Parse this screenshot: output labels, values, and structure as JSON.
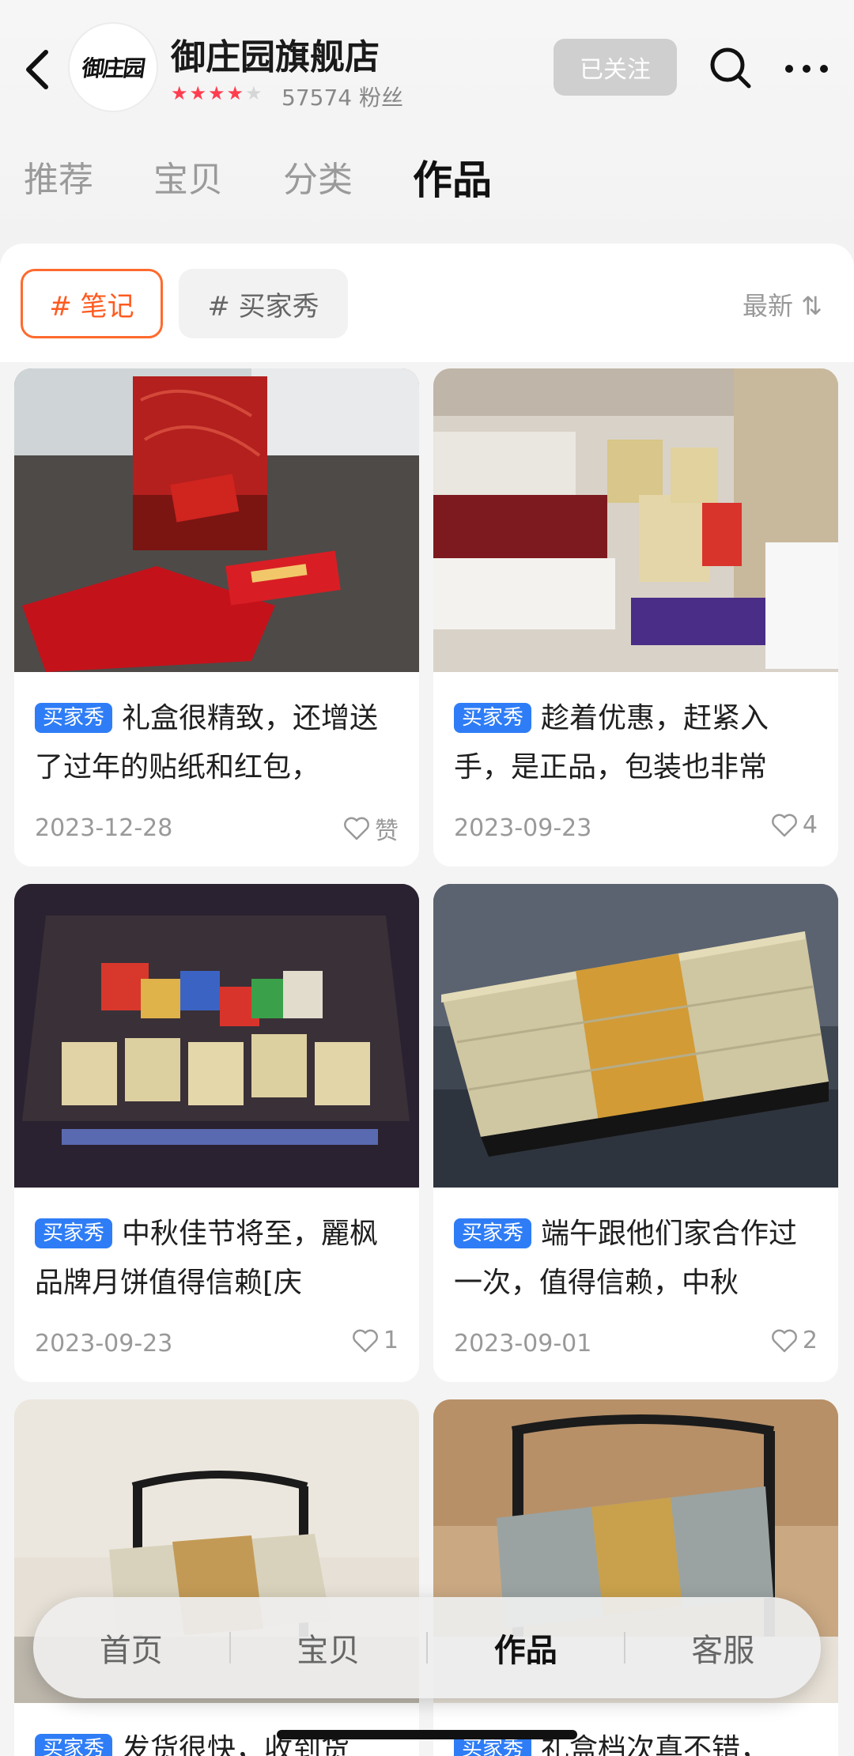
{
  "header": {
    "logo_text": "御庄园",
    "shop_name": "御庄园旗舰店",
    "rating_stars": 4,
    "fans_text": "57574 粉丝",
    "follow_label": "已关注"
  },
  "tabs": [
    {
      "label": "推荐",
      "active": false
    },
    {
      "label": "宝贝",
      "active": false
    },
    {
      "label": "分类",
      "active": false
    },
    {
      "label": "作品",
      "active": true
    }
  ],
  "filters": {
    "note": "# 笔记",
    "buyer_show": "# 买家秀",
    "sort": "最新 ⇅"
  },
  "posts": [
    {
      "badge": "买家秀",
      "title": "礼盒很精致，还增送了过年的贴纸和红包，",
      "date": "2023-12-28",
      "likes": "赞"
    },
    {
      "badge": "买家秀",
      "title": "趁着优惠，赶紧入手，是正品，包装也非常",
      "date": "2023-09-23",
      "likes": "4"
    },
    {
      "badge": "买家秀",
      "title": "中秋佳节将至，麗枫品牌月饼值得信赖[庆",
      "date": "2023-09-23",
      "likes": "1"
    },
    {
      "badge": "买家秀",
      "title": "端午跟他们家合作过一次，值得信赖，中秋",
      "date": "2023-09-01",
      "likes": "2"
    },
    {
      "badge": "买家秀",
      "title": "发货很快，收到货",
      "date": "",
      "likes": ""
    },
    {
      "badge": "买家秀",
      "title": "礼盒档次真不错，",
      "date": "",
      "likes": ""
    }
  ],
  "bottom_nav": [
    {
      "label": "首页",
      "active": false
    },
    {
      "label": "宝贝",
      "active": false
    },
    {
      "label": "作品",
      "active": true
    },
    {
      "label": "客服",
      "active": false
    }
  ],
  "colors": {
    "accent_orange": "#ff5a1f",
    "badge_blue": "#2f7df6",
    "star_red": "#ff3d4e"
  }
}
